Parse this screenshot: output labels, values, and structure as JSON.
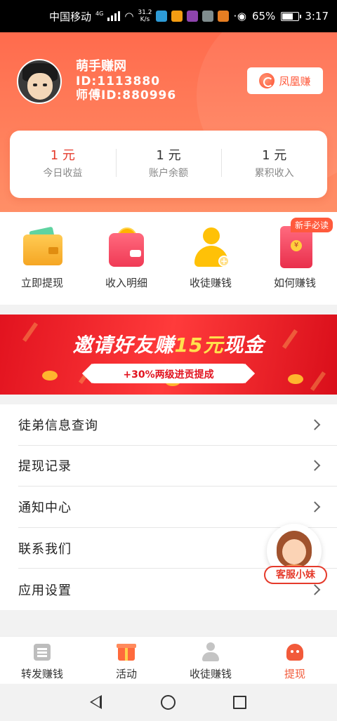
{
  "status_bar": {
    "carrier": "中国移动",
    "network": "4G",
    "speed_value": "31.2",
    "speed_unit": "K/s",
    "more": "···",
    "battery": "65%",
    "time": "3:17"
  },
  "user": {
    "name": "萌手赚网",
    "id_line": "ID:1113880",
    "master_id_line": "师傅ID:880996"
  },
  "brand_button": {
    "label": "凤凰赚"
  },
  "stats": [
    {
      "value": "1 元",
      "label": "今日收益"
    },
    {
      "value": "1 元",
      "label": "账户余额"
    },
    {
      "value": "1 元",
      "label": "累积收入"
    }
  ],
  "actions": [
    {
      "label": "立即提现",
      "icon": "wallet-icon"
    },
    {
      "label": "收入明细",
      "icon": "purse-icon"
    },
    {
      "label": "收徒赚钱",
      "icon": "add-user-icon"
    },
    {
      "label": "如何赚钱",
      "icon": "red-envelope-icon",
      "badge": "新手必读"
    }
  ],
  "banner": {
    "title_pre": "邀请好友赚",
    "title_highlight": "15元",
    "title_post": "现金",
    "subtitle": "+30%两级进贡提成"
  },
  "menu": [
    {
      "label": "徒弟信息查询"
    },
    {
      "label": "提现记录"
    },
    {
      "label": "通知中心"
    },
    {
      "label": "联系我们"
    },
    {
      "label": "应用设置"
    }
  ],
  "service_float": {
    "label": "客服小妹"
  },
  "tabs": [
    {
      "label": "转发赚钱",
      "icon": "document-icon",
      "active": false
    },
    {
      "label": "活动",
      "icon": "gift-icon",
      "active": false
    },
    {
      "label": "收徒赚钱",
      "icon": "user-icon",
      "active": false
    },
    {
      "label": "提现",
      "icon": "ghost-icon",
      "active": true
    }
  ],
  "colors": {
    "accent": "#ff6b4d",
    "highlight": "#e53a2b",
    "banner_red": "#e2131f"
  }
}
